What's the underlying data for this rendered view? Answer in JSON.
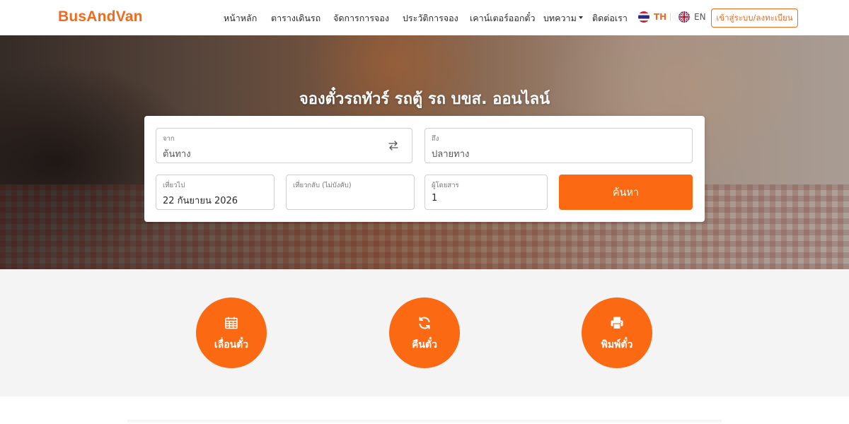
{
  "header": {
    "logo": "BusAndVan",
    "nav": [
      {
        "label": "หน้าหลัก"
      },
      {
        "label": "ตารางเดินรถ"
      },
      {
        "label": "จัดการการจอง"
      },
      {
        "label": "ประวัติการจอง"
      },
      {
        "label": "เคาน์เตอร์ออกตั๋ว"
      },
      {
        "label": "บทความ"
      },
      {
        "label": "ติดต่อเรา"
      }
    ],
    "lang_th": "TH",
    "lang_en": "EN",
    "login": "เข้าสู่ระบบ/ลงทะเบียน"
  },
  "hero": {
    "title": "จองตั๋วรถทัวร์ รถตู้ รถ บขส. ออนไลน์"
  },
  "search": {
    "from_label": "จาก",
    "from_placeholder": "ต้นทาง",
    "to_label": "ถึง",
    "to_placeholder": "ปลายทาง",
    "depart_label": "เที่ยวไป",
    "depart_value": "22 กันยายน 2026",
    "return_label": "เที่ยวกลับ (ไม่บังคับ)",
    "return_value": "",
    "passengers_label": "ผู้โดยสาร",
    "passengers_value": "1",
    "button": "ค้นหา"
  },
  "actions": [
    {
      "label": "เลื่อนตั๋ว",
      "icon": "calendar-icon"
    },
    {
      "label": "คืนตั๋ว",
      "icon": "refresh-icon"
    },
    {
      "label": "พิมพ์ตั๋ว",
      "icon": "print-icon"
    }
  ],
  "colors": {
    "brand": "#f26a1b",
    "button": "#fb6a12",
    "section_bg": "#f4f4f4"
  }
}
